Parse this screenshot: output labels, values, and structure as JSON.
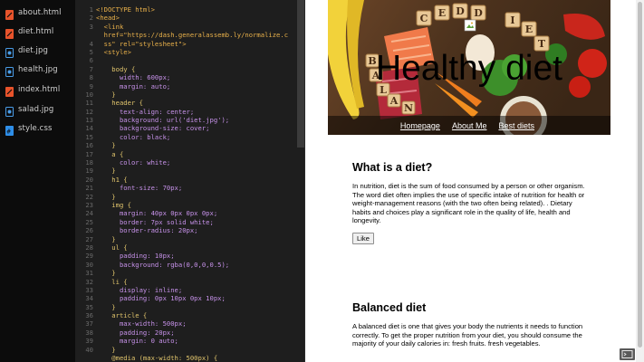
{
  "sidebar": {
    "files": [
      {
        "name": "about.html",
        "icon": "html-file-icon",
        "color": "#e8532b"
      },
      {
        "name": "diet.html",
        "icon": "html-file-icon",
        "color": "#e8532b"
      },
      {
        "name": "diet.jpg",
        "icon": "image-file-icon",
        "color": "#4a9de8"
      },
      {
        "name": "health.jpg",
        "icon": "image-file-icon",
        "color": "#4a9de8"
      },
      {
        "name": "index.html",
        "icon": "html-file-icon",
        "color": "#e8532b"
      },
      {
        "name": "salad.jpg",
        "icon": "image-file-icon",
        "color": "#4a9de8"
      },
      {
        "name": "style.css",
        "icon": "css-file-icon",
        "color": "#2e8ee8"
      }
    ]
  },
  "editor": {
    "lines": [
      "<!DOCTYPE html>",
      "<head>",
      "  <link",
      "  href=\"https://dash.generalassemb.ly/normalize.c",
      "  ss\" rel=\"stylesheet\">",
      "  <style>",
      "",
      "    body {",
      "      width: 600px;",
      "      margin: auto;",
      "    }",
      "    header {",
      "      text-align: center;",
      "      background: url('diet.jpg');",
      "      background-size: cover;",
      "      color: black;",
      "    }",
      "    a {",
      "      color: white;",
      "    }",
      "    h1 {",
      "      font-size: 70px;",
      "    }",
      "    img {",
      "      margin: 40px 0px 0px 0px;",
      "      border: 7px solid white;",
      "      border-radius: 20px;",
      "    }",
      "    ul {",
      "      padding: 10px;",
      "      background: rgba(0,0,0,0.5);",
      "    }",
      "    li {",
      "      display: inline;",
      "      padding: 0px 10px 0px 10px;",
      "    }",
      "    article {",
      "      max-width: 500px;",
      "      padding: 20px;",
      "      margin: 0 auto;",
      "    }",
      "    @media (max-width: 500px) {"
    ],
    "line_numbers": [
      "1",
      "2",
      "3",
      "",
      "4",
      "5",
      "6",
      "7",
      "8",
      "9",
      "10",
      "11",
      "12",
      "13",
      "14",
      "15",
      "16",
      "17",
      "18",
      "19",
      "20",
      "21",
      "22",
      "23",
      "24",
      "25",
      "26",
      "27",
      "28",
      "29",
      "30",
      "31",
      "32",
      "33",
      "34",
      "35",
      "36",
      "37",
      "38",
      "39",
      "40"
    ]
  },
  "preview": {
    "header": {
      "title": "Healthy diet",
      "badge_letters": [
        "B",
        "A",
        "L",
        "A",
        "N",
        "C",
        "E",
        "D",
        "D",
        "I",
        "E",
        "T"
      ],
      "nav": [
        "Homepage",
        "About Me",
        "Best diets"
      ]
    },
    "articles": [
      {
        "heading": "What is a diet?",
        "body": "In nutrition, diet is the sum of food consumed by a person or other organism. The word diet often implies the use of specific intake of nutrition for health or weight-management reasons (with the two often being related). . Dietary habits and choices play a significant role in the quality of life, health and longevity.",
        "button": "Like"
      },
      {
        "heading": "Balanced diet",
        "body": "A balanced diet is one that gives your body the nutrients it needs to function correctly. To get the proper nutrition from your diet, you should consume the majority of your daily calories in: fresh fruits. fresh vegetables."
      }
    ]
  },
  "colors": {
    "sidebar_bg": "#0c0c0c",
    "editor_bg": "#1e1e1e",
    "keyword": "#e0c46c",
    "tag": "#e8b04a",
    "string": "#a6d96b",
    "value": "#c792ea"
  }
}
